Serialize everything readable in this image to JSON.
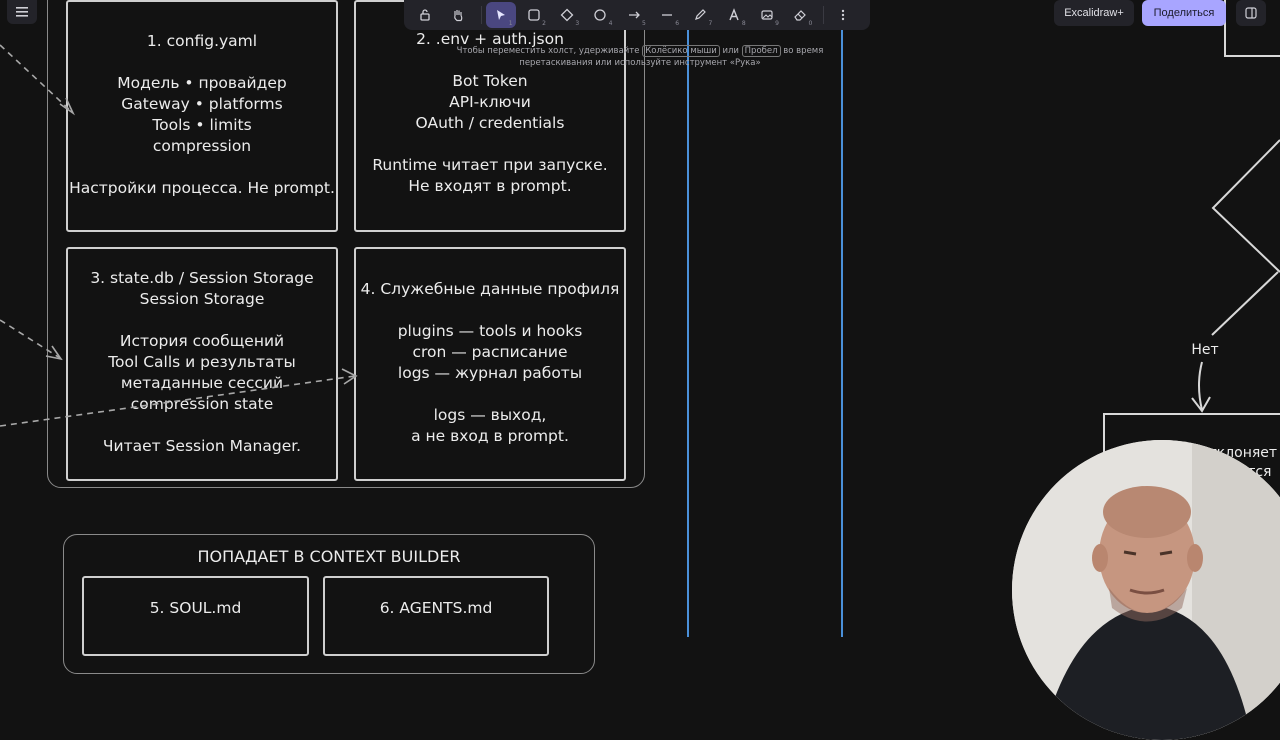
{
  "toolbar": {
    "tools": [
      {
        "icon": "lock-icon",
        "key": ""
      },
      {
        "icon": "hand-icon",
        "key": ""
      },
      {
        "icon": "select-arrow-icon",
        "key": "1",
        "active": true
      },
      {
        "icon": "rectangle-icon",
        "key": "2"
      },
      {
        "icon": "diamond-icon",
        "key": "3"
      },
      {
        "icon": "ellipse-icon",
        "key": "4"
      },
      {
        "icon": "arrow-icon",
        "key": "5"
      },
      {
        "icon": "line-icon",
        "key": "6"
      },
      {
        "icon": "pencil-icon",
        "key": "7"
      },
      {
        "icon": "text-icon",
        "key": "8"
      },
      {
        "icon": "image-icon",
        "key": "9"
      },
      {
        "icon": "eraser-icon",
        "key": "0"
      },
      {
        "icon": "more-icon",
        "key": ""
      }
    ],
    "hint_line1_pre": "Чтобы переместить холст, удерживайте",
    "hint_key1": "Колёсико мыши",
    "hint_or": "или",
    "hint_key2": "Пробел",
    "hint_line1_post": "во время",
    "hint_line2": "перетаскивания или используйте инструмент «Рука»"
  },
  "header": {
    "excalidraw_plus": "Excalidraw+",
    "share": "Поделиться"
  },
  "colors": {
    "accent": "#a8a5ff",
    "guide": "#4a90d9",
    "canvas": "#121212"
  },
  "boxes": {
    "config": {
      "title": "1. config.yaml",
      "lines": [
        "Модель • провайдер",
        "Gateway • platforms",
        "Tools • limits",
        "compression"
      ],
      "footer": "Настройки процесса. Не prompt."
    },
    "env": {
      "title": "2. .env + auth.json",
      "lines": [
        "Bot Token",
        "API-ключи",
        "OAuth / credentials"
      ],
      "footer1": "Runtime читает при запуске.",
      "footer2": "Не входят в prompt."
    },
    "state": {
      "title1": "3. state.db / Session Storage",
      "title2": "Session Storage",
      "lines": [
        "История сообщений",
        "Tool Calls и результаты",
        "метаданные сессий",
        "compression state"
      ],
      "footer": "Читает Session Manager."
    },
    "service": {
      "title": "4. Служебные данные профиля",
      "lines": [
        "plugins — tools и hooks",
        "cron — расписание",
        "logs — журнал работы"
      ],
      "footer1": "logs — выход,",
      "footer2": "а не вход в prompt."
    }
  },
  "context_builder": {
    "title": "ПОПАДАЕТ В CONTEXT BUILDER",
    "soul": "5. SOUL.md",
    "agents": "6. AGENTS.md"
  },
  "flow": {
    "no_label": "Нет",
    "partial1": "отклоняет",
    "partial2": "ается"
  }
}
